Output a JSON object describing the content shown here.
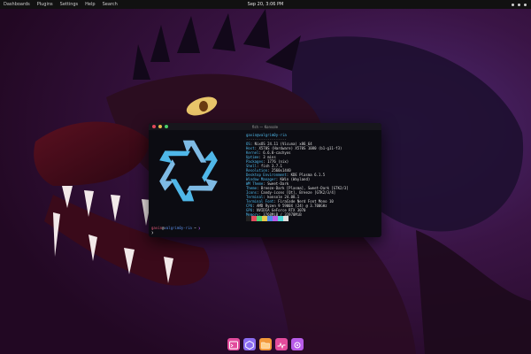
{
  "top_bar": {
    "menu": [
      "Dashboards",
      "Plugins",
      "Settings",
      "Help",
      "Search"
    ],
    "clock": "Sep 20, 3:06 PM"
  },
  "terminal": {
    "title": "fish — Konsole",
    "header": "gavin@valgrim0y-ria",
    "separator": "-------------------",
    "info": [
      {
        "key": "OS",
        "value": "NixOS 24.11 (Vicuna) x86_64"
      },
      {
        "key": "Host",
        "value": "X570S (Hardware) X570S 1080 (b1-g11-f3)"
      },
      {
        "key": "Kernel",
        "value": "6.6.0-cachyos"
      },
      {
        "key": "Uptime",
        "value": "3 mins"
      },
      {
        "key": "Packages",
        "value": "1776 (nix)"
      },
      {
        "key": "Shell",
        "value": "fish 3.7.1"
      },
      {
        "key": "Resolution",
        "value": "2560x1440"
      },
      {
        "key": "Desktop Environment",
        "value": "KDE Plasma 6.1.5"
      },
      {
        "key": "Window Manager",
        "value": "KWin (Wayland)"
      },
      {
        "key": "WM Theme",
        "value": "Sweet-Dark"
      },
      {
        "key": "Theme",
        "value": "Breeze-Dark [Plasma], Sweet-Dark [GTK2/3]"
      },
      {
        "key": "Icons",
        "value": "Candy-icons [Qt], Breeze [GTK2/3/4]"
      },
      {
        "key": "Terminal",
        "value": "konsole 24.08.1"
      },
      {
        "key": "Terminal Font",
        "value": "FiraCode Nerd Font Mono 10"
      },
      {
        "key": "CPU",
        "value": "AMD Ryzen 9 5900X (24) @ 3.700GHz"
      },
      {
        "key": "GPU",
        "value": "NVIDIA GeForce RTX 3070"
      },
      {
        "key": "Memory",
        "value": "3768MiB / 31978MiB"
      }
    ],
    "palette": [
      "#222222",
      "#e24b5c",
      "#4fd67a",
      "#e8c94b",
      "#4f8ce8",
      "#b85be8",
      "#4fd6d6",
      "#dedede"
    ],
    "prompt": {
      "user": "gavin",
      "at": "@",
      "host": "valgrim0y-ria",
      "path": " ~",
      "symbol": " ❯"
    },
    "prompt_second": "❯"
  },
  "dock": {
    "items": [
      {
        "name": "terminal",
        "color": "#e24b9c"
      },
      {
        "name": "browser",
        "color": "#8a6cf0"
      },
      {
        "name": "files",
        "color": "#f2983a"
      },
      {
        "name": "system-monitor",
        "color": "#e24b9c"
      },
      {
        "name": "settings",
        "color": "#b85be8"
      }
    ]
  }
}
